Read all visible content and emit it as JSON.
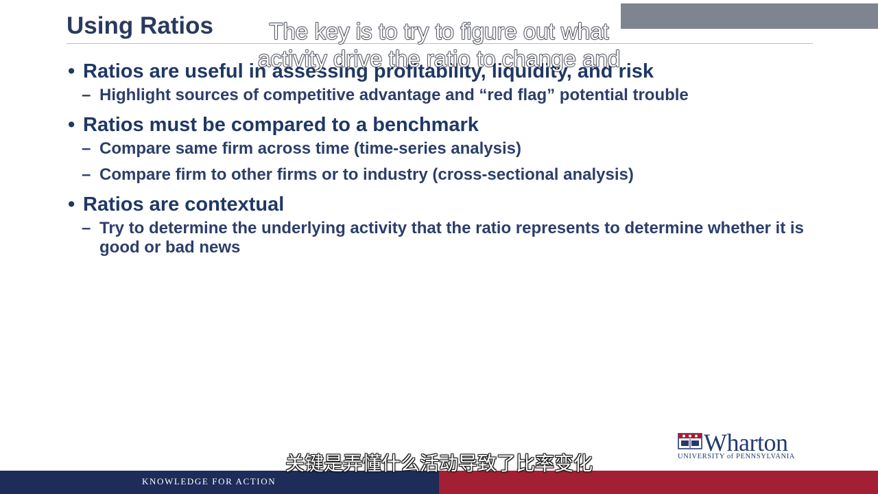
{
  "slide": {
    "title": "Using Ratios",
    "bullets": [
      {
        "text": "Ratios are useful in assessing profitability, liquidity, and risk",
        "subs": [
          "Highlight sources of competitive advantage and “red flag” potential trouble"
        ]
      },
      {
        "text": "Ratios must be compared to a benchmark",
        "subs": [
          "Compare same firm across time (time-series analysis)",
          "Compare firm to other firms or to industry (cross-sectional analysis)"
        ]
      },
      {
        "text": "Ratios are contextual",
        "subs": [
          "Try to determine the underlying activity that the ratio represents to determine whether it is good or bad news"
        ]
      }
    ],
    "bullet_mark": "•",
    "sub_mark": "–"
  },
  "captions": {
    "english_line1": "The key is to try to figure out what",
    "english_line2": "activity drive the ratio to change and",
    "chinese": "关键是弄懂什么活动导致了比率变化"
  },
  "logo": {
    "name": "Wharton",
    "subtitle": "UNIVERSITY of PENNSYLVANIA"
  },
  "footer": {
    "tagline": "KNOWLEDGE FOR ACTION"
  },
  "colors": {
    "title": "#2a3a5e",
    "body": "#1f3864",
    "footer_navy": "#1d2c58",
    "footer_red": "#a31f34",
    "top_bar": "#7f8491"
  }
}
